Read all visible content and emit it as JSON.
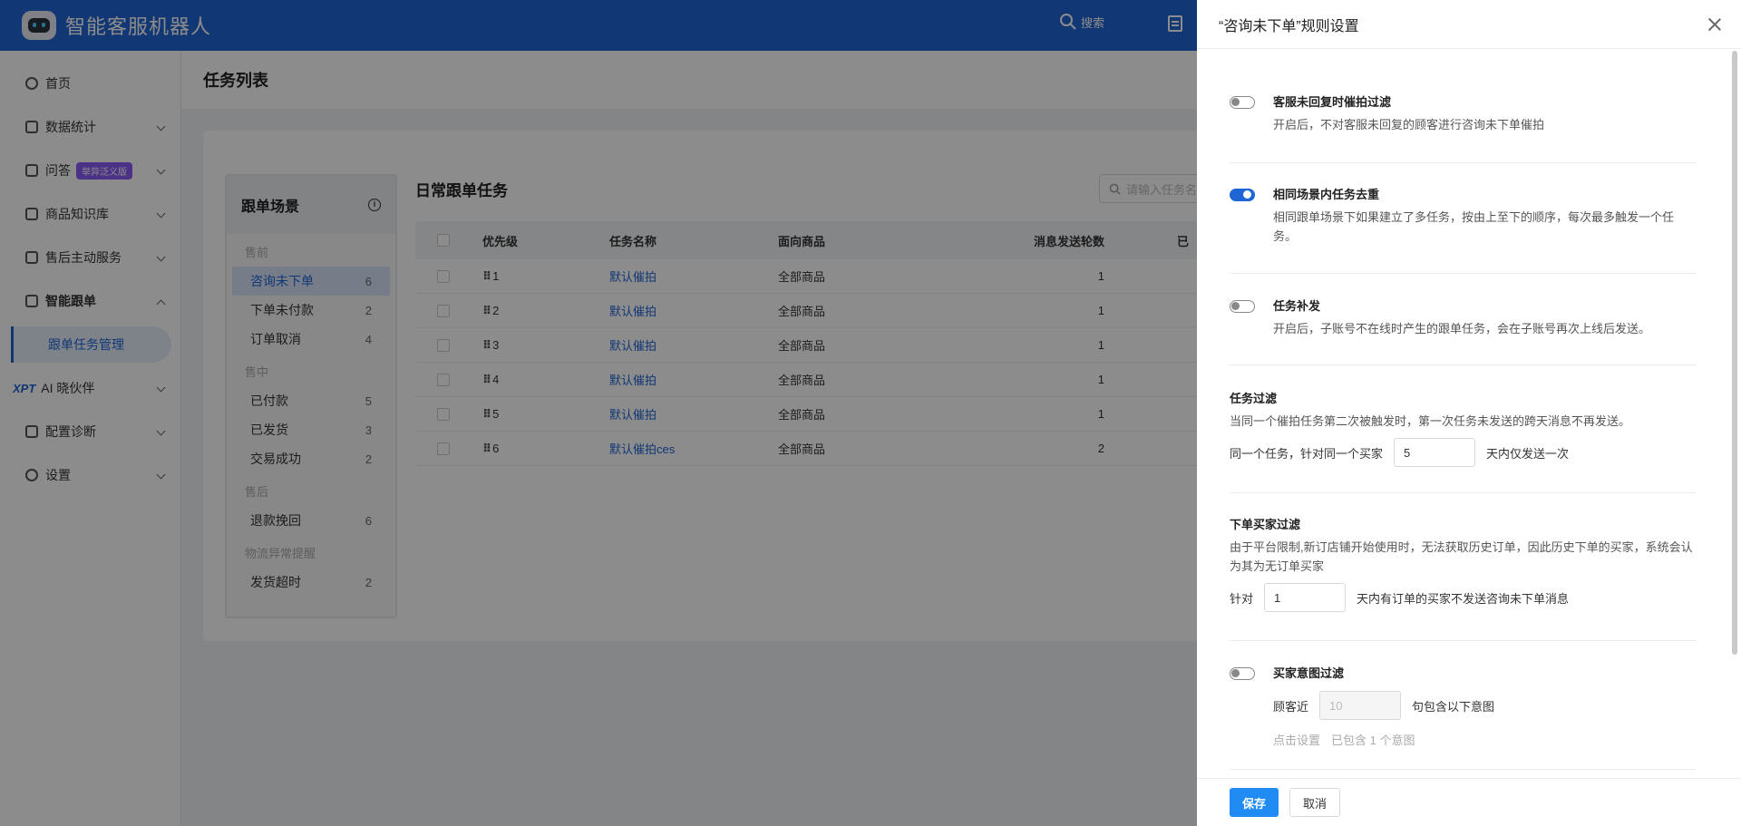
{
  "app": {
    "title": "智能客服机器人",
    "search_label": "搜索"
  },
  "sidebar": {
    "items": [
      {
        "label": "首页"
      },
      {
        "label": "数据统计"
      },
      {
        "label": "问答",
        "badge": "举异泛义版"
      },
      {
        "label": "商品知识库"
      },
      {
        "label": "售后主动服务"
      },
      {
        "label": "智能跟单"
      },
      {
        "label": "AI 晓伙伴",
        "prefix": "XPT"
      },
      {
        "label": "配置诊断"
      },
      {
        "label": "设置"
      }
    ],
    "sub_active": "跟单任务管理"
  },
  "main": {
    "title": "任务列表",
    "scene_panel": {
      "title": "跟单场景",
      "groups": [
        {
          "name": "售前",
          "items": [
            {
              "label": "咨询未下单",
              "count": "6"
            },
            {
              "label": "下单未付款",
              "count": "2"
            },
            {
              "label": "订单取消",
              "count": "4"
            }
          ]
        },
        {
          "name": "售中",
          "items": [
            {
              "label": "已付款",
              "count": "5"
            },
            {
              "label": "已发货",
              "count": "3"
            },
            {
              "label": "交易成功",
              "count": "2"
            }
          ]
        },
        {
          "name": "售后",
          "items": [
            {
              "label": "退款挽回",
              "count": "6"
            }
          ]
        },
        {
          "name": "物流异常提醒",
          "items": [
            {
              "label": "发货超时",
              "count": "2"
            }
          ]
        }
      ]
    },
    "list_title": "日常跟单任务",
    "search_placeholder": "请输入任务名",
    "table": {
      "headers": [
        "优先级",
        "任务名称",
        "面向商品",
        "消息发送轮数",
        "已"
      ],
      "rows": [
        {
          "priority": "1",
          "name": "默认催拍",
          "goods": "全部商品",
          "rounds": "1"
        },
        {
          "priority": "2",
          "name": "默认催拍",
          "goods": "全部商品",
          "rounds": "1"
        },
        {
          "priority": "3",
          "name": "默认催拍",
          "goods": "全部商品",
          "rounds": "1"
        },
        {
          "priority": "4",
          "name": "默认催拍",
          "goods": "全部商品",
          "rounds": "1"
        },
        {
          "priority": "5",
          "name": "默认催拍",
          "goods": "全部商品",
          "rounds": "1"
        },
        {
          "priority": "6",
          "name": "默认催拍ces",
          "goods": "全部商品",
          "rounds": "2"
        }
      ]
    }
  },
  "drawer": {
    "title": "“咨询未下单”规则设置",
    "no_reply": {
      "enabled": false,
      "title": "客服未回复时催拍过滤",
      "desc": "开启后，不对客服未回复的顾客进行咨询未下单催拍"
    },
    "dedupe": {
      "enabled": true,
      "title": "相同场景内任务去重",
      "desc": "相同跟单场景下如果建立了多任务，按由上至下的顺序，每次最多触发一个任务。"
    },
    "resend": {
      "enabled": false,
      "title": "任务补发",
      "desc": "开启后，子账号不在线时产生的跟单任务，会在子账号再次上线后发送。"
    },
    "task_filter": {
      "title": "任务过滤",
      "desc": "当同一个催拍任务第二次被触发时，第一次任务未发送的跨天消息不再发送。",
      "prefix": "同一个任务，针对同一个买家",
      "value": "5",
      "suffix": "天内仅发送一次"
    },
    "order_filter": {
      "title": "下单买家过滤",
      "desc": "由于平台限制,新订店铺开始使用时，无法获取历史订单，因此历史下单的买家，系统会认为其为无订单买家",
      "prefix": "针对",
      "value": "1",
      "suffix": "天内有订单的买家不发送咨询未下单消息"
    },
    "intent_filter": {
      "enabled": false,
      "title": "买家意图过滤",
      "prefix": "顾客近",
      "value": "10",
      "suffix": "句包含以下意图",
      "link": "点击设置",
      "info": "已包含 1 个意图"
    },
    "save_label": "保存",
    "cancel_label": "取消"
  }
}
